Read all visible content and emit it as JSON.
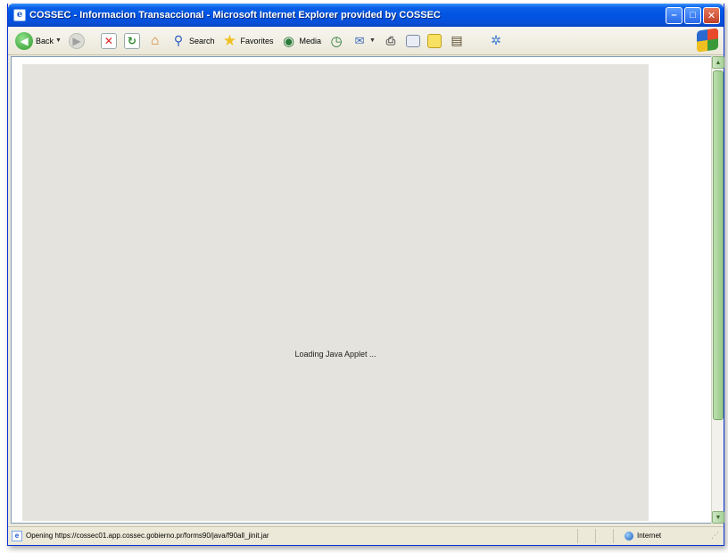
{
  "window": {
    "title": "COSSEC - Informacion Transaccional - Microsoft Internet Explorer provided by COSSEC",
    "minimize_glyph": "–",
    "maximize_glyph": "□",
    "close_glyph": "✕"
  },
  "toolbar": {
    "back_label": "Back",
    "search_label": "Search",
    "favorites_label": "Favorites",
    "media_label": "Media"
  },
  "content": {
    "applet_status": "Loading Java Applet ..."
  },
  "statusbar": {
    "text": "Opening https://cossec01.app.cossec.gobierno.pr/forms90/java/f90all_jinit.jar",
    "zone": "Internet"
  }
}
